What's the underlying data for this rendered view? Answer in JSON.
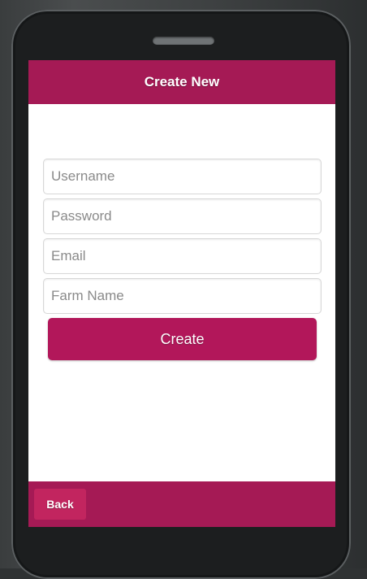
{
  "header": {
    "title": "Create New"
  },
  "form": {
    "username_placeholder": "Username",
    "password_placeholder": "Password",
    "email_placeholder": "Email",
    "farm_name_placeholder": "Farm Name",
    "create_label": "Create"
  },
  "footer": {
    "back_label": "Back"
  },
  "colors": {
    "accent": "#a51a55",
    "button": "#b2175a",
    "device_frame": "#1c1e1f"
  }
}
